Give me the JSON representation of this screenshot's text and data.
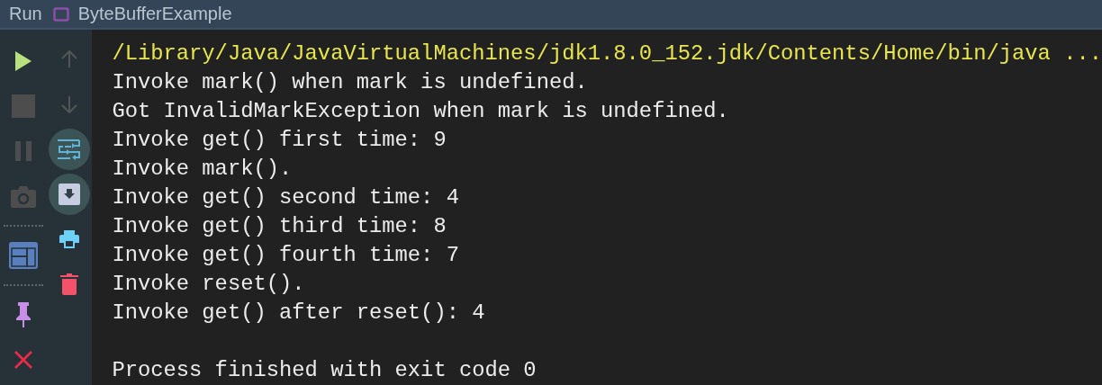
{
  "header": {
    "label": "Run",
    "title": "ByteBufferExample"
  },
  "toolbar_left": [
    {
      "kind": "run",
      "disabled": false
    },
    {
      "kind": "stop",
      "disabled": true
    },
    {
      "kind": "pause",
      "disabled": true
    },
    {
      "kind": "snapshot",
      "disabled": true
    },
    {
      "kind": "separator"
    },
    {
      "kind": "layout",
      "disabled": false
    },
    {
      "kind": "separator"
    },
    {
      "kind": "pin",
      "disabled": false
    },
    {
      "kind": "close",
      "disabled": false
    }
  ],
  "toolbar_right": [
    {
      "kind": "up",
      "disabled": true,
      "on": false
    },
    {
      "kind": "down",
      "disabled": true,
      "on": false
    },
    {
      "kind": "wrap",
      "disabled": false,
      "on": true
    },
    {
      "kind": "scroll",
      "disabled": false,
      "on": true
    },
    {
      "kind": "print",
      "disabled": false,
      "on": false
    },
    {
      "kind": "delete",
      "disabled": false,
      "on": false
    }
  ],
  "console": [
    {
      "kind": "command",
      "text": "/Library/Java/JavaVirtualMachines/jdk1.8.0_152.jdk/Contents/Home/bin/java ..."
    },
    {
      "kind": "output",
      "text": "Invoke mark() when mark is undefined."
    },
    {
      "kind": "output",
      "text": "Got InvalidMarkException when mark is undefined."
    },
    {
      "kind": "output",
      "text": "Invoke get() first time: 9"
    },
    {
      "kind": "output",
      "text": "Invoke mark()."
    },
    {
      "kind": "output",
      "text": "Invoke get() second time: 4"
    },
    {
      "kind": "output",
      "text": "Invoke get() third time: 8"
    },
    {
      "kind": "output",
      "text": "Invoke get() fourth time: 7"
    },
    {
      "kind": "output",
      "text": "Invoke reset()."
    },
    {
      "kind": "output",
      "text": "Invoke get() after reset(): 4"
    },
    {
      "kind": "exit",
      "text": "Process finished with exit code 0"
    }
  ]
}
